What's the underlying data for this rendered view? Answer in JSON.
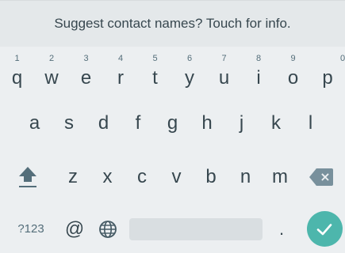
{
  "suggestion": {
    "text": "Suggest contact names? Touch for info."
  },
  "keyboard": {
    "row1": [
      {
        "label": "q",
        "hint": "1"
      },
      {
        "label": "w",
        "hint": "2"
      },
      {
        "label": "e",
        "hint": "3"
      },
      {
        "label": "r",
        "hint": "4"
      },
      {
        "label": "t",
        "hint": "5"
      },
      {
        "label": "y",
        "hint": "6"
      },
      {
        "label": "u",
        "hint": "7"
      },
      {
        "label": "i",
        "hint": "8"
      },
      {
        "label": "o",
        "hint": "9"
      },
      {
        "label": "p",
        "hint": "0"
      }
    ],
    "row2": [
      "a",
      "s",
      "d",
      "f",
      "g",
      "h",
      "j",
      "k",
      "l"
    ],
    "row3": [
      "z",
      "x",
      "c",
      "v",
      "b",
      "n",
      "m"
    ],
    "bottom": {
      "symbols_label": "?123",
      "at_label": "@",
      "period_label": "."
    },
    "icons": {
      "shift": "shift-icon",
      "backspace": "backspace-icon",
      "language": "globe-icon",
      "enter": "checkmark-icon"
    },
    "colors": {
      "background": "#eceff1",
      "suggestion_bar": "#e4e8ea",
      "key_text": "#37474f",
      "enter": "#4db6ac"
    }
  }
}
